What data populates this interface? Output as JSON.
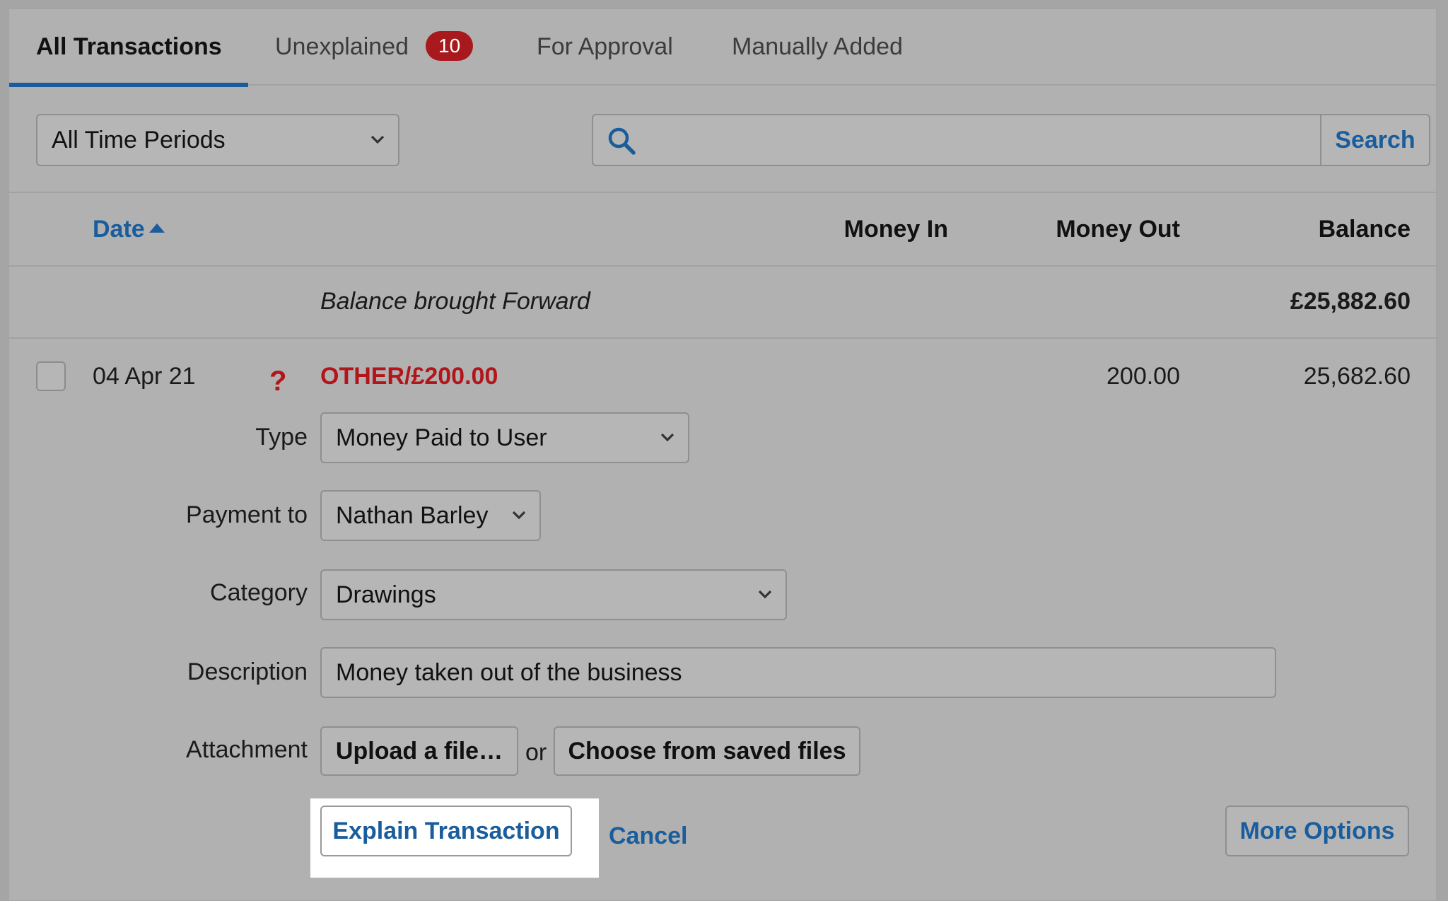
{
  "tabs": [
    {
      "label": "All Transactions",
      "active": true
    },
    {
      "label": "Unexplained",
      "badge": "10"
    },
    {
      "label": "For Approval"
    },
    {
      "label": "Manually Added"
    }
  ],
  "filters": {
    "period_selected": "All Time Periods",
    "search_value": "",
    "search_button": "Search"
  },
  "columns": {
    "date": "Date",
    "money_in": "Money In",
    "money_out": "Money Out",
    "balance": "Balance"
  },
  "balance_forward": {
    "label": "Balance brought Forward",
    "amount": "£25,882.60"
  },
  "transaction": {
    "date": "04 Apr 21",
    "status_icon": "?",
    "description": "OTHER/£200.00",
    "money_out": "200.00",
    "balance": "25,682.60"
  },
  "form": {
    "type_label": "Type",
    "type_value": "Money Paid to User",
    "payment_label": "Payment to",
    "payment_value": "Nathan Barley",
    "category_label": "Category",
    "category_value": "Drawings",
    "description_label": "Description",
    "description_value": "Money taken out of the business",
    "attachment_label": "Attachment",
    "upload_button": "Upload a file…",
    "or_text": "or",
    "saved_files_button": "Choose from saved files",
    "explain_button": "Explain Transaction",
    "cancel_link": "Cancel",
    "more_options_button": "More Options"
  },
  "colors": {
    "accent": "#1a5d9c",
    "badge": "#a8191d",
    "unexplained_text": "#b2161b"
  }
}
